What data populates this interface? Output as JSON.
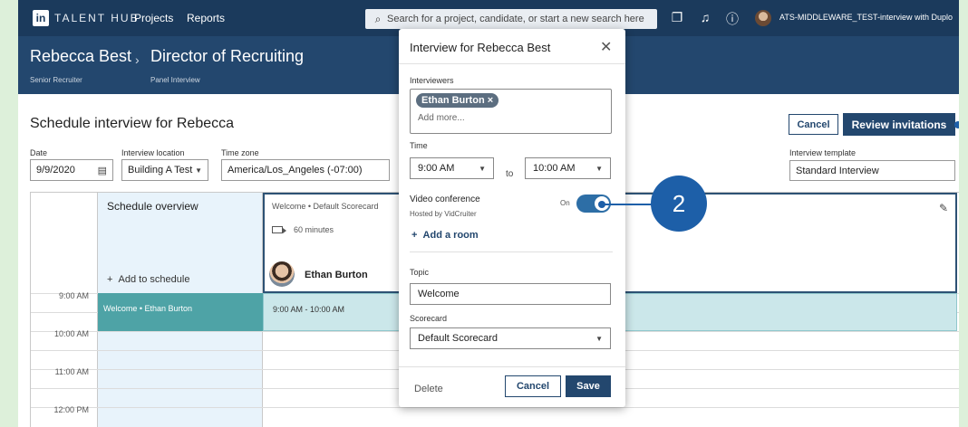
{
  "topnav": {
    "logo": "in",
    "brand": "TALENT HUB",
    "links": [
      "Projects",
      "Reports"
    ],
    "search_placeholder": "Search for a project, candidate, or start a new search here",
    "user_label": "ATS-MIDDLEWARE_TEST-interview with Duplo"
  },
  "header": {
    "candidate": "Rebecca Best",
    "separator": "›",
    "job": "Director of Recruiting",
    "role": "Senior Recruiter",
    "stage": "Panel Interview"
  },
  "schedule": {
    "title": "Schedule interview for Rebecca",
    "date_label": "Date",
    "date_value": "9/9/2020",
    "location_label": "Interview location",
    "location_value": "Building A Test",
    "timezone_label": "Time zone",
    "timezone_value": "America/Los_Angeles (-07:00)",
    "template_label": "Interview template",
    "template_value": "Standard Interview",
    "cancel_label": "Cancel",
    "review_label": "Review invitations"
  },
  "calendar": {
    "overview_title": "Schedule overview",
    "add_to_schedule": "Add to schedule",
    "card_header": "Welcome  •  Default Scorecard",
    "card_duration": "60 minutes",
    "interviewer": "Ethan Burton",
    "times": [
      "9:00 AM",
      "10:00 AM",
      "11:00 AM",
      "12:00 PM"
    ],
    "event_label": "Welcome • Ethan Burton",
    "event_range": "9:00 AM - 10:00 AM"
  },
  "modal": {
    "title": "Interview for Rebecca Best",
    "interviewers_label": "Interviewers",
    "interviewer_chip": "Ethan Burton ×",
    "add_more_placeholder": "Add more...",
    "time_label": "Time",
    "start_time": "9:00 AM",
    "to_label": "to",
    "end_time": "10:00 AM",
    "video_label": "Video conference",
    "video_host": "Hosted by VidCruiter",
    "video_state": "On",
    "add_room": "Add a room",
    "topic_label": "Topic",
    "topic_value": "Welcome",
    "scorecard_label": "Scorecard",
    "scorecard_value": "Default Scorecard",
    "delete_label": "Delete",
    "cancel_label": "Cancel",
    "save_label": "Save"
  },
  "callout": {
    "number": "2"
  }
}
